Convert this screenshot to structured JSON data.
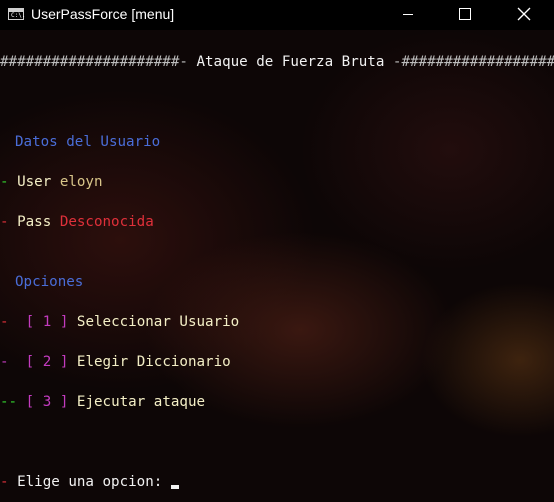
{
  "window": {
    "title": "UserPassForce [menu]",
    "app_icon_text": "C:\\.",
    "controls": [
      "minimize",
      "maximize",
      "close"
    ]
  },
  "console": {
    "banner": {
      "left": "#####################-",
      "title": " Ataque de Fuerza Bruta ",
      "right": "-##################"
    },
    "user_section": {
      "heading": "Datos del Usuario",
      "user_prefix": "-",
      "user_label": "User",
      "user_value": "eloyn",
      "pass_prefix": "-",
      "pass_label": "Pass",
      "pass_value": "Desconocida"
    },
    "options_section": {
      "heading": "Opciones",
      "items": [
        {
          "prefix": "-",
          "bracket_open": "[",
          "key": "1",
          "bracket_close": "]",
          "label": "Seleccionar Usuario"
        },
        {
          "prefix": "-",
          "bracket_open": "[",
          "key": "2",
          "bracket_close": "]",
          "label": "Elegir Diccionario"
        },
        {
          "prefix": "--",
          "bracket_open": "[",
          "key": "3",
          "bracket_close": "]",
          "label": "Ejecutar ataque"
        }
      ]
    },
    "prompt": {
      "prefix": "-",
      "text": "Elige una opcion:"
    }
  },
  "colors": {
    "heading": "#4a6dd8",
    "text": "#f4efc6",
    "error": "#e0303a",
    "key": "#c33bbf",
    "dash_green": "#34d02e",
    "dash_red": "#e0303a",
    "dash_magenta": "#c33bbf"
  }
}
